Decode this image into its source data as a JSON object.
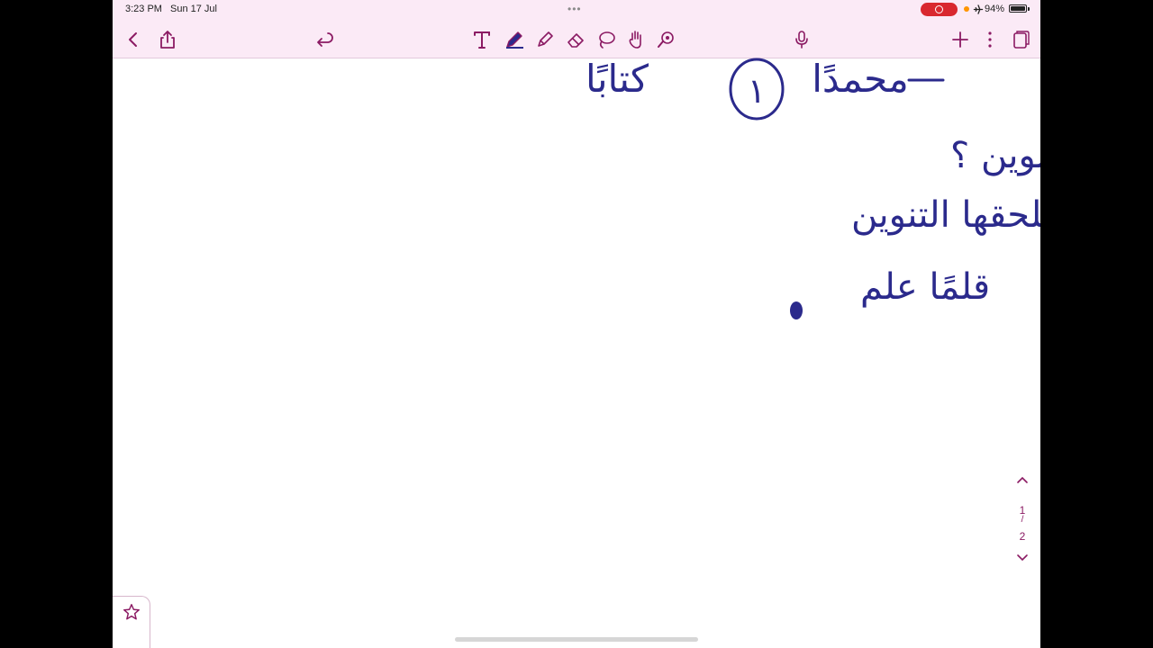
{
  "status_bar": {
    "time": "3:23 PM",
    "date": "Sun 17 Jul",
    "battery": "94%",
    "icons": [
      "screen-recording-icon",
      "airplane-icon",
      "battery-icon"
    ]
  },
  "toolbar": {
    "left": [
      "back-icon",
      "share-icon",
      "undo-icon"
    ],
    "tools": [
      "text-tool-icon",
      "pen-tool-icon",
      "highlighter-tool-icon",
      "eraser-tool-icon",
      "lasso-tool-icon",
      "hand-tool-icon",
      "laser-pointer-icon"
    ],
    "right": [
      "microphone-icon",
      "add-icon",
      "more-icon",
      "pages-icon"
    ]
  },
  "note": {
    "ink_color": "#2b2a8c",
    "lines": [
      "محمدًا (١) كتابًا  —",
      "* متى تكتب ألف التنوين ؟",
      "تكتب في جميع الأحوال التي يلحقها التنوين",
      "قلمًا علم"
    ]
  },
  "page_nav": {
    "current": "1",
    "separator": "/",
    "total": "2"
  },
  "colors": {
    "accent": "#8b1a63",
    "toolbar_bg": "#fbeaf6",
    "record": "#d9282f"
  }
}
